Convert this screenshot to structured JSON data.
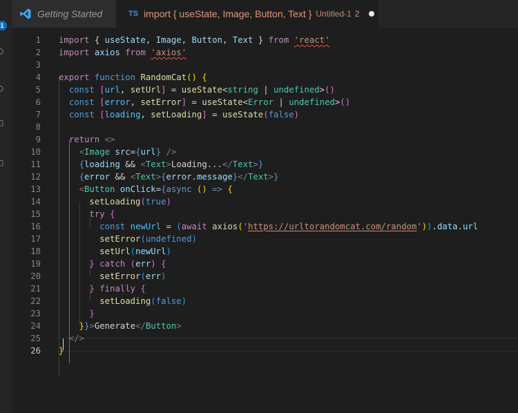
{
  "activity": {
    "badge": "1"
  },
  "tabs": [
    {
      "label": "Getting Started"
    },
    {
      "lang": "TS",
      "file": "import { useState, Image, Button, Text }",
      "desc": "Untitled-1",
      "count": "2"
    }
  ],
  "editor": {
    "current_line": 26,
    "lines": [
      {
        "n": "1",
        "t": [
          [
            "k",
            "import"
          ],
          [
            "d",
            " { "
          ],
          [
            "v",
            "useState"
          ],
          [
            "d",
            ", "
          ],
          [
            "v",
            "Image"
          ],
          [
            "d",
            ", "
          ],
          [
            "v",
            "Button"
          ],
          [
            "d",
            ", "
          ],
          [
            "v",
            "Text"
          ],
          [
            "d",
            " } "
          ],
          [
            "k",
            "from"
          ],
          [
            "d",
            " "
          ],
          [
            "s sq",
            "'react'"
          ]
        ]
      },
      {
        "n": "2",
        "t": [
          [
            "k",
            "import"
          ],
          [
            "d",
            " "
          ],
          [
            "v",
            "axios"
          ],
          [
            "d",
            " "
          ],
          [
            "k",
            "from"
          ],
          [
            "d",
            " "
          ],
          [
            "s sq",
            "'axios'"
          ]
        ]
      },
      {
        "n": "3",
        "t": []
      },
      {
        "n": "4",
        "t": [
          [
            "k",
            "export"
          ],
          [
            "d",
            " "
          ],
          [
            "b",
            "function"
          ],
          [
            "d",
            " "
          ],
          [
            "f",
            "RandomCat"
          ],
          [
            "y",
            "()"
          ],
          [
            "d",
            " "
          ],
          [
            "y",
            "{"
          ]
        ]
      },
      {
        "n": "5",
        "t": [
          [
            "d",
            "  "
          ],
          [
            "b",
            "const"
          ],
          [
            "d",
            " "
          ],
          [
            "pk",
            "["
          ],
          [
            "c",
            "url"
          ],
          [
            "d",
            ", "
          ],
          [
            "f",
            "setUrl"
          ],
          [
            "pk",
            "]"
          ],
          [
            "d",
            " = "
          ],
          [
            "f",
            "useState"
          ],
          [
            "d",
            "<"
          ],
          [
            "t",
            "string"
          ],
          [
            "d",
            " | "
          ],
          [
            "t",
            "undefined"
          ],
          [
            "d",
            ">"
          ],
          [
            "pk",
            "()"
          ]
        ]
      },
      {
        "n": "6",
        "t": [
          [
            "d",
            "  "
          ],
          [
            "b",
            "const"
          ],
          [
            "d",
            " "
          ],
          [
            "pk",
            "["
          ],
          [
            "c",
            "error"
          ],
          [
            "d",
            ", "
          ],
          [
            "f",
            "setError"
          ],
          [
            "pk",
            "]"
          ],
          [
            "d",
            " = "
          ],
          [
            "f",
            "useState"
          ],
          [
            "d",
            "<"
          ],
          [
            "t",
            "Error"
          ],
          [
            "d",
            " | "
          ],
          [
            "t",
            "undefined"
          ],
          [
            "d",
            ">"
          ],
          [
            "pk",
            "()"
          ]
        ]
      },
      {
        "n": "7",
        "t": [
          [
            "d",
            "  "
          ],
          [
            "b",
            "const"
          ],
          [
            "d",
            " "
          ],
          [
            "pk",
            "["
          ],
          [
            "c",
            "loading"
          ],
          [
            "d",
            ", "
          ],
          [
            "f",
            "setLoading"
          ],
          [
            "pk",
            "]"
          ],
          [
            "d",
            " = "
          ],
          [
            "f",
            "useState"
          ],
          [
            "pk",
            "("
          ],
          [
            "b",
            "false"
          ],
          [
            "pk",
            ")"
          ]
        ]
      },
      {
        "n": "8",
        "t": []
      },
      {
        "n": "9",
        "t": [
          [
            "d",
            "  "
          ],
          [
            "k",
            "return"
          ],
          [
            "d",
            " "
          ],
          [
            "p",
            "<>"
          ]
        ]
      },
      {
        "n": "10",
        "t": [
          [
            "d",
            "    "
          ],
          [
            "p",
            "<"
          ],
          [
            "t",
            "Image"
          ],
          [
            "d",
            " "
          ],
          [
            "v",
            "src"
          ],
          [
            "d",
            "="
          ],
          [
            "b",
            "{"
          ],
          [
            "v",
            "url"
          ],
          [
            "b",
            "}"
          ],
          [
            "d",
            " "
          ],
          [
            "p",
            "/>"
          ]
        ]
      },
      {
        "n": "11",
        "t": [
          [
            "d",
            "    "
          ],
          [
            "b",
            "{"
          ],
          [
            "v",
            "loading"
          ],
          [
            "d",
            " && "
          ],
          [
            "p",
            "<"
          ],
          [
            "t",
            "Text"
          ],
          [
            "p",
            ">"
          ],
          [
            "d",
            "Loading..."
          ],
          [
            "p",
            "</"
          ],
          [
            "t",
            "Text"
          ],
          [
            "p",
            ">"
          ],
          [
            "b",
            "}"
          ]
        ]
      },
      {
        "n": "12",
        "t": [
          [
            "d",
            "    "
          ],
          [
            "b",
            "{"
          ],
          [
            "v",
            "error"
          ],
          [
            "d",
            " && "
          ],
          [
            "p",
            "<"
          ],
          [
            "t",
            "Text"
          ],
          [
            "p",
            ">"
          ],
          [
            "b",
            "{"
          ],
          [
            "v",
            "error"
          ],
          [
            "d",
            "."
          ],
          [
            "v",
            "message"
          ],
          [
            "b",
            "}"
          ],
          [
            "p",
            "</"
          ],
          [
            "t",
            "Text"
          ],
          [
            "p",
            ">"
          ],
          [
            "b",
            "}"
          ]
        ]
      },
      {
        "n": "13",
        "t": [
          [
            "d",
            "    "
          ],
          [
            "p",
            "<"
          ],
          [
            "t",
            "Button"
          ],
          [
            "d",
            " "
          ],
          [
            "v",
            "onClick"
          ],
          [
            "d",
            "="
          ],
          [
            "b",
            "{"
          ],
          [
            "b",
            "async"
          ],
          [
            "d",
            " "
          ],
          [
            "y",
            "()"
          ],
          [
            "d",
            " "
          ],
          [
            "b",
            "=>"
          ],
          [
            "d",
            " "
          ],
          [
            "y",
            "{"
          ]
        ]
      },
      {
        "n": "14",
        "t": [
          [
            "d",
            "      "
          ],
          [
            "f",
            "setLoading"
          ],
          [
            "pk",
            "("
          ],
          [
            "b",
            "true"
          ],
          [
            "pk",
            ")"
          ]
        ]
      },
      {
        "n": "15",
        "t": [
          [
            "d",
            "      "
          ],
          [
            "k",
            "try"
          ],
          [
            "d",
            " "
          ],
          [
            "pk",
            "{"
          ]
        ]
      },
      {
        "n": "16",
        "t": [
          [
            "d",
            "        "
          ],
          [
            "b",
            "const"
          ],
          [
            "d",
            " "
          ],
          [
            "c",
            "newUrl"
          ],
          [
            "d",
            " = "
          ],
          [
            "bl",
            "("
          ],
          [
            "k",
            "await"
          ],
          [
            "d",
            " "
          ],
          [
            "f",
            "axios"
          ],
          [
            "y",
            "("
          ],
          [
            "s",
            "'"
          ],
          [
            "s ul",
            "https://urltorandomcat.com/random"
          ],
          [
            "s",
            "'"
          ],
          [
            "y",
            ")"
          ],
          [
            "bl",
            ")"
          ],
          [
            "d",
            "."
          ],
          [
            "v",
            "data"
          ],
          [
            "d",
            "."
          ],
          [
            "v",
            "url"
          ]
        ]
      },
      {
        "n": "17",
        "t": [
          [
            "d",
            "        "
          ],
          [
            "f",
            "setError"
          ],
          [
            "bl",
            "("
          ],
          [
            "b",
            "undefined"
          ],
          [
            "bl",
            ")"
          ]
        ]
      },
      {
        "n": "18",
        "t": [
          [
            "d",
            "        "
          ],
          [
            "f",
            "setUrl"
          ],
          [
            "bl",
            "("
          ],
          [
            "v",
            "newUrl"
          ],
          [
            "bl",
            ")"
          ]
        ]
      },
      {
        "n": "19",
        "t": [
          [
            "d",
            "      "
          ],
          [
            "pk",
            "}"
          ],
          [
            "d",
            " "
          ],
          [
            "k",
            "catch"
          ],
          [
            "d",
            " "
          ],
          [
            "pk",
            "("
          ],
          [
            "v",
            "err"
          ],
          [
            "pk",
            ")"
          ],
          [
            "d",
            " "
          ],
          [
            "pk",
            "{"
          ]
        ]
      },
      {
        "n": "20",
        "t": [
          [
            "d",
            "        "
          ],
          [
            "f",
            "setError"
          ],
          [
            "bl",
            "("
          ],
          [
            "v",
            "err"
          ],
          [
            "bl",
            ")"
          ]
        ]
      },
      {
        "n": "21",
        "t": [
          [
            "d",
            "      "
          ],
          [
            "pk",
            "}"
          ],
          [
            "d",
            " "
          ],
          [
            "k",
            "finally"
          ],
          [
            "d",
            " "
          ],
          [
            "pk",
            "{"
          ]
        ]
      },
      {
        "n": "22",
        "t": [
          [
            "d",
            "        "
          ],
          [
            "f",
            "setLoading"
          ],
          [
            "bl",
            "("
          ],
          [
            "b",
            "false"
          ],
          [
            "bl",
            ")"
          ]
        ]
      },
      {
        "n": "23",
        "t": [
          [
            "d",
            "      "
          ],
          [
            "pk",
            "}"
          ]
        ]
      },
      {
        "n": "24",
        "t": [
          [
            "d",
            "    "
          ],
          [
            "y",
            "}"
          ],
          [
            "b",
            "}"
          ],
          [
            "p",
            ">"
          ],
          [
            "d",
            "Generate"
          ],
          [
            "p",
            "</"
          ],
          [
            "t",
            "Button"
          ],
          [
            "p",
            ">"
          ]
        ]
      },
      {
        "n": "25",
        "t": [
          [
            "d",
            "  "
          ],
          [
            "p",
            "</>"
          ]
        ]
      },
      {
        "n": "26",
        "t": [
          [
            "y",
            "}"
          ]
        ]
      }
    ]
  }
}
